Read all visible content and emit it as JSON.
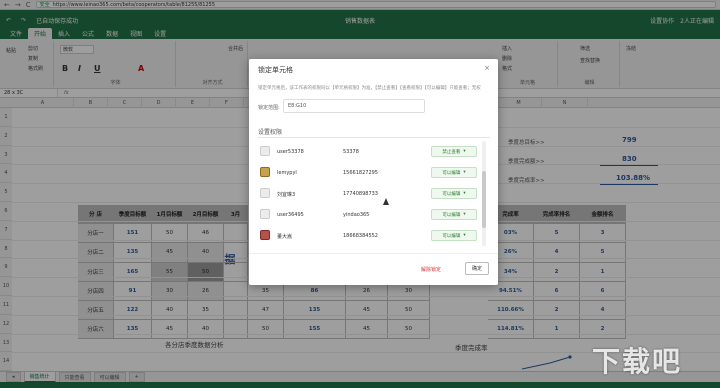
{
  "browser": {
    "back": "←",
    "forward": "→",
    "reload": "C",
    "secure": "安全",
    "url": "https://www.leinao365.com/beta/cooperators/table/81255/81255"
  },
  "app": {
    "autosave": "已自动保存成功",
    "title": "销售数据表",
    "users": "2人正在编辑",
    "settings": "设置协作"
  },
  "menus": [
    "文件",
    "开始",
    "插入",
    "公式",
    "数据",
    "视图",
    "设置"
  ],
  "ribbon": {
    "paste": "粘贴",
    "cut": "剪切",
    "copy": "复制",
    "format_painter": "格式刷",
    "font_name": "微软",
    "bold": "B",
    "italic": "I",
    "underline": "U",
    "font_color": "A",
    "group_font": "字体",
    "group_align": "对齐方式",
    "merge": "合并后",
    "wrap": "自动换行",
    "number_format": "常规",
    "insert": "插入",
    "delete": "删除",
    "format": "格式",
    "group_cells": "单元格",
    "sort": "筛选",
    "find": "查找替换",
    "group_edit": "编辑",
    "freeze": "冻结",
    "group_style": "样式"
  },
  "formula_bar": {
    "namebox": "28 x 3C",
    "fx": "fx"
  },
  "columns": [
    "A",
    "B",
    "C",
    "D",
    "E",
    "F",
    "G",
    "H",
    "I",
    "J",
    "K",
    "L",
    "M",
    "N"
  ],
  "rows": [
    "1",
    "2",
    "3",
    "4",
    "5",
    "6",
    "7",
    "8",
    "9",
    "10",
    "11",
    "12",
    "13",
    "14"
  ],
  "sheet_title": "销售数据",
  "table": {
    "headers": [
      "分 店",
      "季度目标额",
      "1月目标额",
      "2月目标额",
      "3月"
    ],
    "rows": [
      {
        "label": "分店一",
        "target": "151",
        "m1": "50",
        "m2": "46"
      },
      {
        "label": "分店二",
        "target": "135",
        "m1": "45",
        "m2": "40"
      },
      {
        "label": "分店三",
        "target": "165",
        "m1": "55",
        "m2": "50"
      },
      {
        "label": "分店四",
        "target": "91",
        "m1": "30",
        "m2": "26"
      },
      {
        "label": "分店五",
        "target": "122",
        "m1": "40",
        "m2": "35"
      },
      {
        "label": "分店六",
        "target": "135",
        "m1": "45",
        "m2": "40"
      }
    ],
    "extra_rows": [
      {
        "m3": "35",
        "total": "86",
        "a1": "26",
        "a2": "30"
      },
      {
        "m3": "47",
        "total": "135",
        "a1": "45",
        "a2": "50"
      },
      {
        "m3": "50",
        "total": "155",
        "a1": "45",
        "a2": "50"
      }
    ]
  },
  "right_table": {
    "headers": [
      "完成率",
      "完成率排名",
      "金额排名"
    ],
    "rows": [
      {
        "rate": "03%",
        "rank1": "5",
        "rank2": "3"
      },
      {
        "rate": "26%",
        "rank1": "4",
        "rank2": "5"
      },
      {
        "rate": "34%",
        "rank1": "2",
        "rank2": "1"
      },
      {
        "rate": "94.51%",
        "rank1": "6",
        "rank2": "6"
      },
      {
        "rate": "110.66%",
        "rank1": "2",
        "rank2": "4"
      },
      {
        "rate": "114.81%",
        "rank1": "1",
        "rank2": "2"
      }
    ]
  },
  "stats": [
    {
      "label": "季度总目标>>",
      "value": "799"
    },
    {
      "label": "季度完成额>>",
      "value": "830"
    },
    {
      "label": "季度完成率>>",
      "value": "103.88%"
    }
  ],
  "chart_titles": {
    "left": "各分店季度数据分析",
    "right": "季度完成率"
  },
  "sheet_tabs": [
    "销售统计",
    "只能查看",
    "可以编辑",
    "+"
  ],
  "dialog": {
    "title": "锁定单元格",
    "close": "×",
    "description": "锁定单元格后，该工作表的权限同以【单元格权限】为准，【禁止查看】【查看权限】【可以编辑】只能查看；无权",
    "range_label": "锁定范围:",
    "range_value": "E8:G10",
    "perm_title": "设置权限",
    "users": [
      {
        "name": "user53378",
        "phone": "53378",
        "perm": "禁止查看"
      },
      {
        "name": "lemypyl",
        "phone": "15661827295",
        "perm": "可以编辑"
      },
      {
        "name": "刘宜琳3",
        "phone": "17740898733",
        "perm": "可以编辑"
      },
      {
        "name": "user36495",
        "phone": "yindao365",
        "perm": "可以编辑"
      },
      {
        "name": "董大嵩",
        "phone": "18668384552",
        "perm": "可以编辑"
      }
    ],
    "caret": "▾",
    "unlock": "解除锁定",
    "ok": "确定"
  },
  "watermark": "下载吧"
}
